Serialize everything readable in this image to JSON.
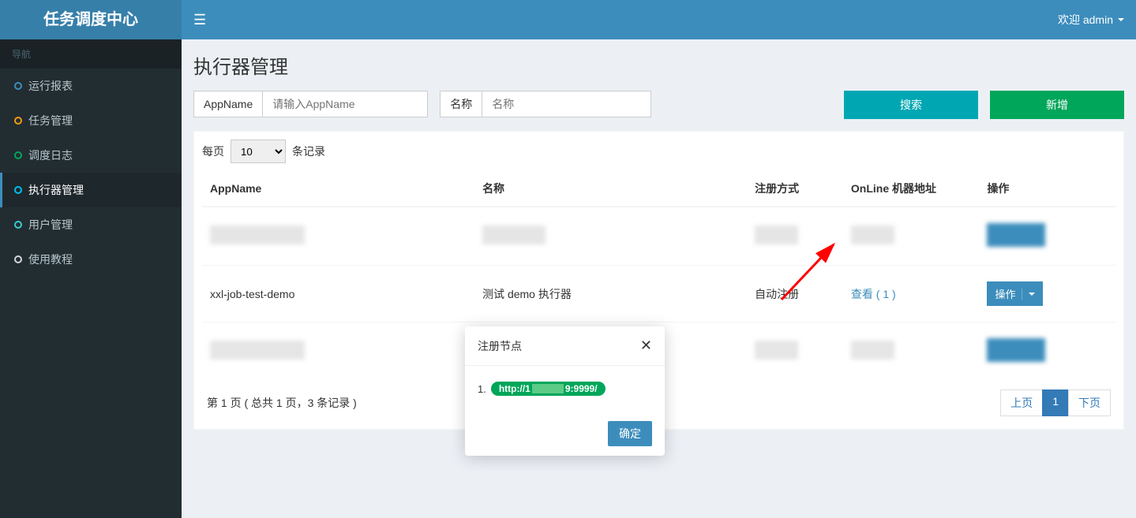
{
  "brand": "任务调度中心",
  "nav_header": "导航",
  "nav": [
    {
      "label": "运行报表",
      "cls": "ci-blue"
    },
    {
      "label": "任务管理",
      "cls": "ci-yellow"
    },
    {
      "label": "调度日志",
      "cls": "ci-green"
    },
    {
      "label": "执行器管理",
      "cls": "ci-cyan",
      "active": true
    },
    {
      "label": "用户管理",
      "cls": "ci-teal"
    },
    {
      "label": "使用教程",
      "cls": "ci-white"
    }
  ],
  "welcome": "欢迎 admin",
  "page_title": "执行器管理",
  "filter": {
    "app_label": "AppName",
    "app_placeholder": "请输入AppName",
    "name_label": "名称",
    "name_placeholder": "名称",
    "search": "搜索",
    "add": "新增"
  },
  "table": {
    "per_page_prefix": "每页",
    "per_page_value": "10",
    "per_page_suffix": "条记录",
    "cols": {
      "app": "AppName",
      "name": "名称",
      "reg": "注册方式",
      "online": "OnLine 机器地址",
      "op": "操作"
    },
    "row_main": {
      "app": "xxl-job-test-demo",
      "name": "测试 demo 执行器",
      "reg": "自动注册",
      "view": "查看 ( 1 )",
      "op": "操作"
    },
    "footer_info": "第 1 页 ( 总共 1 页，3 条记录 )",
    "prev": "上页",
    "page1": "1",
    "next": "下页"
  },
  "modal": {
    "title": "注册节点",
    "item_index": "1.",
    "pill_prefix": "http://1",
    "pill_suffix": "9:9999/",
    "confirm": "确定"
  }
}
